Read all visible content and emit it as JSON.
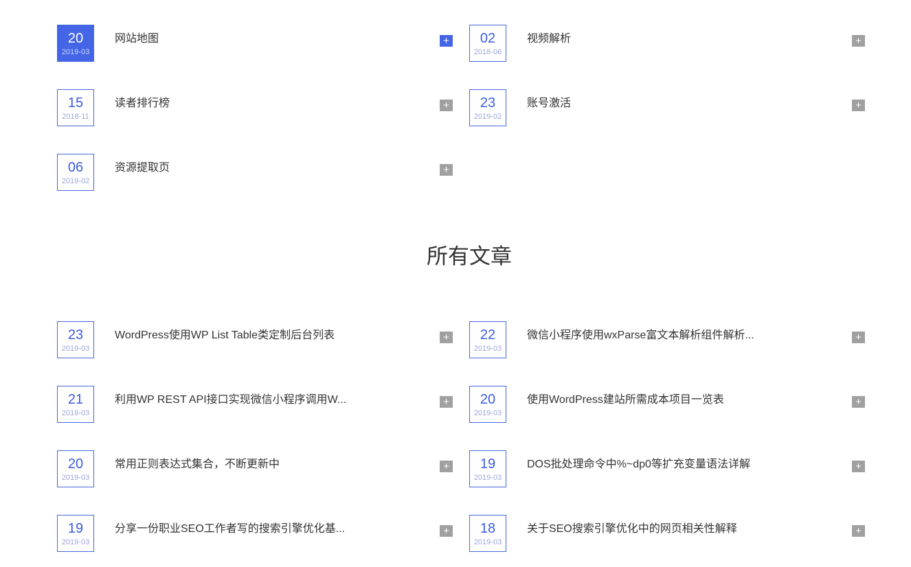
{
  "pages": [
    {
      "day": "20",
      "ym": "2019-03",
      "title": "网站地图",
      "active": true
    },
    {
      "day": "02",
      "ym": "2018-06",
      "title": "视频解析"
    },
    {
      "day": "15",
      "ym": "2018-11",
      "title": "读者排行榜"
    },
    {
      "day": "23",
      "ym": "2019-02",
      "title": "账号激活"
    },
    {
      "day": "06",
      "ym": "2019-02",
      "title": "资源提取页"
    }
  ],
  "section_title": "所有文章",
  "articles": [
    {
      "day": "23",
      "ym": "2019-03",
      "title": "WordPress使用WP List Table类定制后台列表"
    },
    {
      "day": "22",
      "ym": "2019-03",
      "title": "微信小程序使用wxParse富文本解析组件解析..."
    },
    {
      "day": "21",
      "ym": "2019-03",
      "title": "利用WP REST API接口实现微信小程序调用W..."
    },
    {
      "day": "20",
      "ym": "2019-03",
      "title": "使用WordPress建站所需成本项目一览表"
    },
    {
      "day": "20",
      "ym": "2019-03",
      "title": "常用正则表达式集合，不断更新中"
    },
    {
      "day": "19",
      "ym": "2019-03",
      "title": "DOS批处理命令中%~dp0等扩充变量语法详解"
    },
    {
      "day": "19",
      "ym": "2019-03",
      "title": "分享一份职业SEO工作者写的搜索引擎优化基..."
    },
    {
      "day": "18",
      "ym": "2019-03",
      "title": "关于SEO搜索引擎优化中的网页相关性解释"
    }
  ],
  "expand_symbol": "+"
}
